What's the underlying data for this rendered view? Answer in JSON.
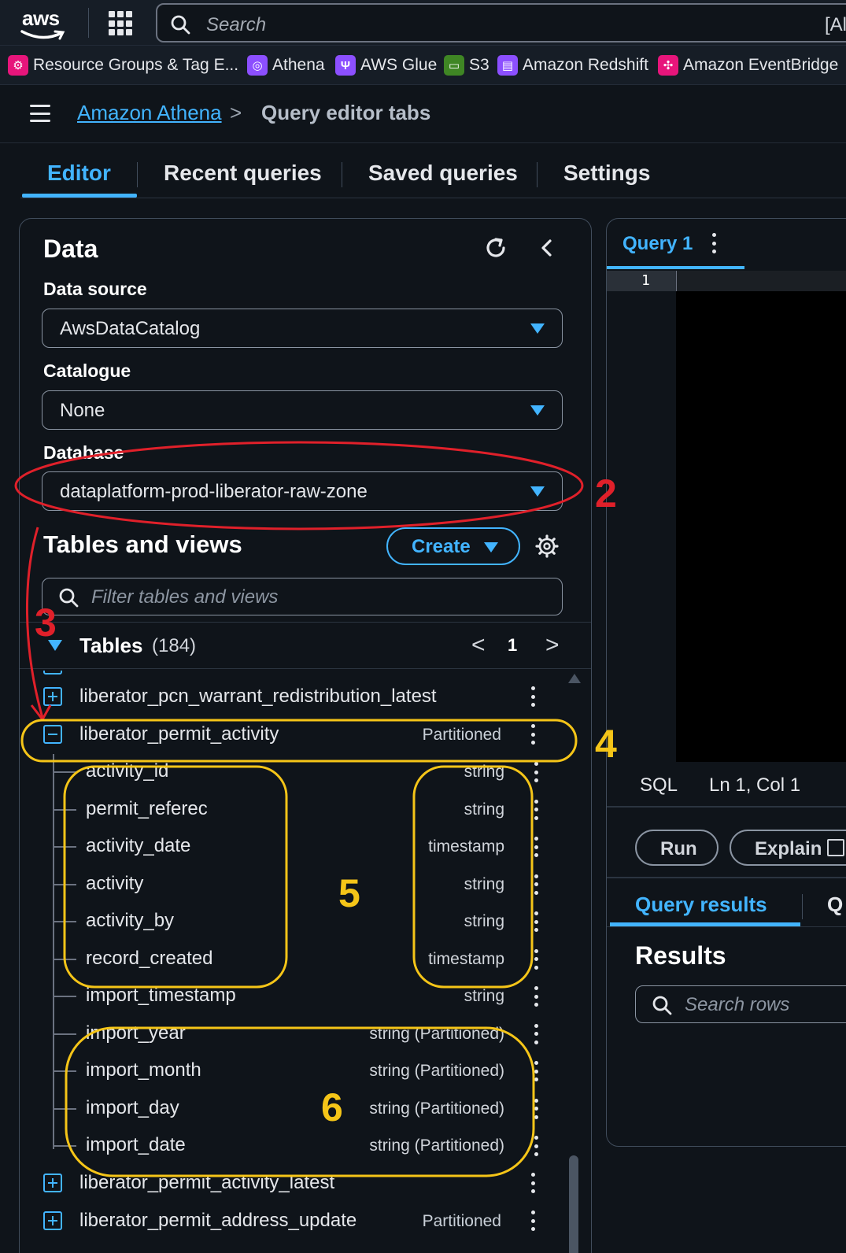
{
  "topnav": {
    "logo_text": "aws",
    "search_placeholder": "Search",
    "search_right_text": "[Al"
  },
  "favorites": [
    {
      "label": "Resource Groups & Tag E...",
      "icon": "resource-groups-icon",
      "color": "#e7157b"
    },
    {
      "label": "Athena",
      "icon": "athena-icon",
      "color": "#8c4fff"
    },
    {
      "label": "AWS Glue",
      "icon": "glue-icon",
      "color": "#8c4fff"
    },
    {
      "label": "S3",
      "icon": "s3-icon",
      "color": "#3f8624"
    },
    {
      "label": "Amazon Redshift",
      "icon": "redshift-icon",
      "color": "#8c4fff"
    },
    {
      "label": "Amazon EventBridge",
      "icon": "eventbridge-icon",
      "color": "#e7157b"
    }
  ],
  "breadcrumb": {
    "link": "Amazon Athena",
    "separator": ">",
    "current": "Query editor tabs"
  },
  "tabs": [
    "Editor",
    "Recent queries",
    "Saved queries",
    "Settings"
  ],
  "data_panel": {
    "title": "Data",
    "data_source_label": "Data source",
    "data_source_value": "AwsDataCatalog",
    "catalogue_label": "Catalogue",
    "catalogue_value": "None",
    "database_label": "Database",
    "database_value": "dataplatform-prod-liberator-raw-zone",
    "tables_views_title": "Tables and views",
    "create_label": "Create",
    "filter_placeholder": "Filter tables and views",
    "tables_label": "Tables",
    "tables_count": "(184)",
    "page_prev": "<",
    "page_number": "1",
    "page_next": ">"
  },
  "tree": {
    "tables_before": [
      {
        "name": "liberator_pcn_warrant_redistribution_latest",
        "tag": ""
      }
    ],
    "expanded_table": {
      "name": "liberator_permit_activity",
      "tag": "Partitioned"
    },
    "columns": [
      {
        "name": "activity_id",
        "type": "string"
      },
      {
        "name": "permit_referec",
        "type": "string"
      },
      {
        "name": "activity_date",
        "type": "timestamp"
      },
      {
        "name": "activity",
        "type": "string"
      },
      {
        "name": "activity_by",
        "type": "string"
      },
      {
        "name": "record_created",
        "type": "timestamp"
      },
      {
        "name": "import_timestamp",
        "type": "string"
      },
      {
        "name": "import_year",
        "type": "string (Partitioned)"
      },
      {
        "name": "import_month",
        "type": "string (Partitioned)"
      },
      {
        "name": "import_day",
        "type": "string (Partitioned)"
      },
      {
        "name": "import_date",
        "type": "string (Partitioned)"
      }
    ],
    "tables_after": [
      {
        "name": "liberator_permit_activity_latest",
        "tag": ""
      },
      {
        "name": "liberator_permit_address_update",
        "tag": "Partitioned"
      }
    ]
  },
  "query_editor": {
    "tab_label": "Query 1",
    "line_number": "1",
    "status_lang": "SQL",
    "status_pos": "Ln 1, Col 1",
    "run_label": "Run",
    "explain_label": "Explain",
    "results_tab": "Query results",
    "results_tab2": "Q",
    "results_title": "Results",
    "search_rows_placeholder": "Search rows"
  },
  "annotations": {
    "step2": "2",
    "step3": "3",
    "step4": "4",
    "step5": "5",
    "step6": "6",
    "red_color": "#e0202a",
    "yellow_color": "#f5c518"
  }
}
